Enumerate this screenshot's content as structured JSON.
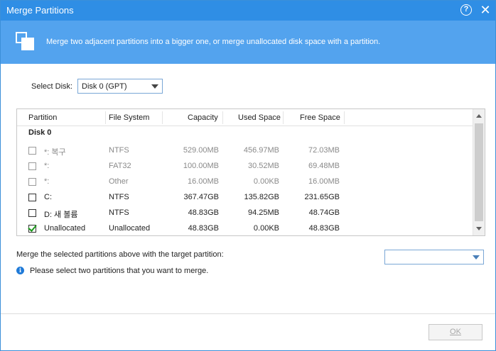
{
  "window": {
    "title": "Merge Partitions",
    "help_icon": "help-icon",
    "close_icon": "close-icon",
    "help_glyph": "?",
    "close_glyph": "✕"
  },
  "banner": {
    "icon": "merge-partitions-icon",
    "text": "Merge two adjacent partitions into a bigger one, or merge unallocated disk space with a partition."
  },
  "disk_select": {
    "label": "Select Disk:",
    "value": "Disk 0 (GPT)"
  },
  "table": {
    "columns": [
      "Partition",
      "File System",
      "Capacity",
      "Used Space",
      "Free Space"
    ],
    "group_label": "Disk 0",
    "rows": [
      {
        "partition": "*: 복구",
        "fs": "NTFS",
        "capacity": "529.00MB",
        "used": "456.97MB",
        "free": "72.03MB",
        "checked": false,
        "enabled": false
      },
      {
        "partition": "*:",
        "fs": "FAT32",
        "capacity": "100.00MB",
        "used": "30.52MB",
        "free": "69.48MB",
        "checked": false,
        "enabled": false
      },
      {
        "partition": "*:",
        "fs": "Other",
        "capacity": "16.00MB",
        "used": "0.00KB",
        "free": "16.00MB",
        "checked": false,
        "enabled": false
      },
      {
        "partition": "C:",
        "fs": "NTFS",
        "capacity": "367.47GB",
        "used": "135.82GB",
        "free": "231.65GB",
        "checked": false,
        "enabled": true
      },
      {
        "partition": "D:  새 볼륨",
        "fs": "NTFS",
        "capacity": "48.83GB",
        "used": "94.25MB",
        "free": "48.74GB",
        "checked": false,
        "enabled": true
      },
      {
        "partition": "Unallocated",
        "fs": "Unallocated",
        "capacity": "48.83GB",
        "used": "0.00KB",
        "free": "48.83GB",
        "checked": true,
        "enabled": true
      }
    ]
  },
  "merge": {
    "label": "Merge the selected partitions above with the target partition:",
    "target_value": ""
  },
  "info": {
    "icon": "info-icon",
    "glyph": "i",
    "text": "Please select two partitions that you want to merge."
  },
  "buttons": {
    "ok": "OK"
  },
  "colors": {
    "titlebar": "#2f8ee5",
    "banner": "#53a3ee",
    "check": "#1b9a1b",
    "disabled_text": "#8a8a8a"
  }
}
